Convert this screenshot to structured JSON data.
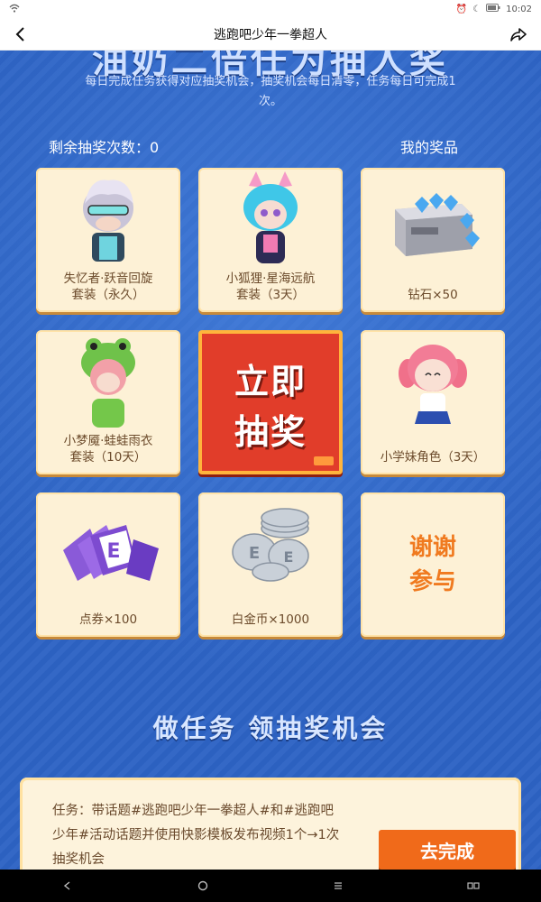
{
  "status_bar": {
    "time": "10:02",
    "wifi_icon": "wifi-icon"
  },
  "nav": {
    "title": "逃跑吧少年一拳超人",
    "back_icon": "back-arrow-icon",
    "share_icon": "share-icon"
  },
  "banner": {
    "title": "油奶二倍任为抽人奖",
    "description": "每日完成任务获得对应抽奖机会，抽奖机会每日清零，任务每日可完成1次。"
  },
  "lottery": {
    "remaining_label": "剩余抽奖次数：",
    "remaining_count": "0",
    "my_prizes_label": "我的奖品",
    "draw_button": {
      "line1": "立即",
      "line2": "抽奖"
    },
    "prizes": [
      {
        "line1": "失忆者·跃音回旋",
        "line2": "套装（永久）"
      },
      {
        "line1": "小狐狸·星海远航",
        "line2": "套装（3天）"
      },
      {
        "line1": "钻石×50",
        "line2": ""
      },
      {
        "line1": "小梦魇·蛙蛙雨衣",
        "line2": "套装（10天）"
      },
      {
        "line1": "小学妹角色（3天）",
        "line2": ""
      },
      {
        "line1": "点券×100",
        "line2": ""
      },
      {
        "line1": "白金币×1000",
        "line2": ""
      }
    ],
    "thanks": {
      "line1": "谢谢",
      "line2": "参与"
    }
  },
  "tasks": {
    "section_title": "做任务 领抽奖机会",
    "items": [
      {
        "text": "任务：带话题#逃跑吧少年一拳超人#和#逃跑吧少年#活动话题并使用快影模板发布视频1个→1次抽奖机会",
        "button": "去完成"
      }
    ]
  },
  "colors": {
    "background": "#2d63c4",
    "card": "#fdf1d6",
    "draw_button": "#e13d2a",
    "task_button": "#f06a1a",
    "card_text": "#6b4a2b"
  }
}
